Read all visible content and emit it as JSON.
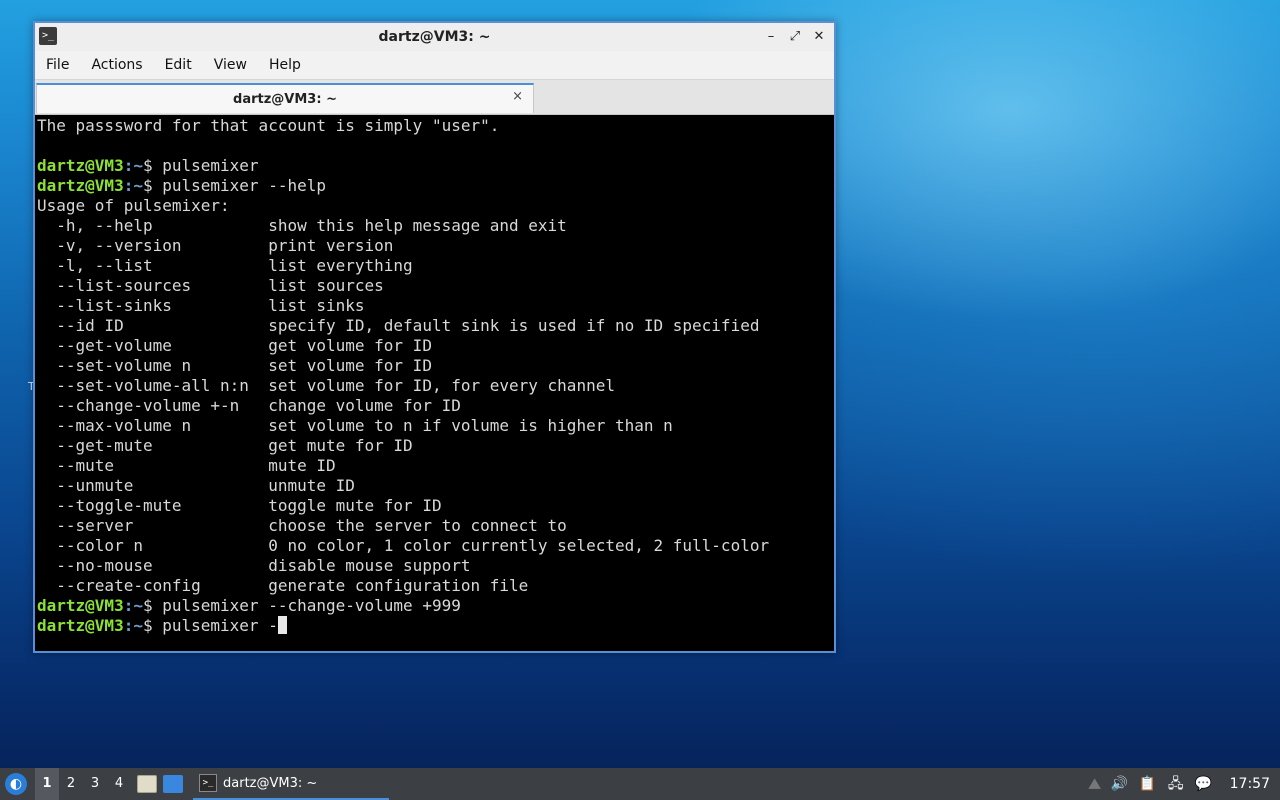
{
  "window": {
    "title": "dartz@VM3: ~",
    "app_icon": ">_",
    "controls": {
      "minimize": "–",
      "maximize": "⤢",
      "close": "✕"
    }
  },
  "menu": {
    "items": [
      "File",
      "Actions",
      "Edit",
      "View",
      "Help"
    ]
  },
  "tab": {
    "label": "dartz@VM3: ~",
    "close": "×"
  },
  "terminal": {
    "prompt_user": "dartz@VM3",
    "prompt_path": ":~",
    "prompt_symbol": "$ ",
    "lines": [
      {
        "type": "text",
        "text": "The passsword for that account is simply \"user\"."
      },
      {
        "type": "text",
        "text": ""
      },
      {
        "type": "prompt",
        "text": "pulsemixer"
      },
      {
        "type": "prompt",
        "text": "pulsemixer --help"
      },
      {
        "type": "text",
        "text": "Usage of pulsemixer:"
      },
      {
        "type": "text",
        "text": "  -h, --help            show this help message and exit"
      },
      {
        "type": "text",
        "text": "  -v, --version         print version"
      },
      {
        "type": "text",
        "text": "  -l, --list            list everything"
      },
      {
        "type": "text",
        "text": "  --list-sources        list sources"
      },
      {
        "type": "text",
        "text": "  --list-sinks          list sinks"
      },
      {
        "type": "text",
        "text": "  --id ID               specify ID, default sink is used if no ID specified"
      },
      {
        "type": "text",
        "text": "  --get-volume          get volume for ID"
      },
      {
        "type": "text",
        "text": "  --set-volume n        set volume for ID"
      },
      {
        "type": "text",
        "text": "  --set-volume-all n:n  set volume for ID, for every channel"
      },
      {
        "type": "text",
        "text": "  --change-volume +-n   change volume for ID"
      },
      {
        "type": "text",
        "text": "  --max-volume n        set volume to n if volume is higher than n"
      },
      {
        "type": "text",
        "text": "  --get-mute            get mute for ID"
      },
      {
        "type": "text",
        "text": "  --mute                mute ID"
      },
      {
        "type": "text",
        "text": "  --unmute              unmute ID"
      },
      {
        "type": "text",
        "text": "  --toggle-mute         toggle mute for ID"
      },
      {
        "type": "text",
        "text": "  --server              choose the server to connect to"
      },
      {
        "type": "text",
        "text": "  --color n             0 no color, 1 color currently selected, 2 full-color"
      },
      {
        "type": "text",
        "text": "  --no-mouse            disable mouse support"
      },
      {
        "type": "text",
        "text": "  --create-config       generate configuration file"
      },
      {
        "type": "prompt",
        "text": "pulsemixer --change-volume +999"
      },
      {
        "type": "prompt_active",
        "text": "pulsemixer -"
      }
    ]
  },
  "taskbar": {
    "start_icon": "start-menu-icon",
    "workspaces": [
      "1",
      "2",
      "3",
      "4"
    ],
    "active_workspace": "1",
    "task_label": "dartz@VM3: ~",
    "clock": "17:57"
  },
  "desktop": {
    "edge_glyph": "T"
  },
  "colors": {
    "prompt_user": "#8ae234",
    "prompt_path": "#729fcf",
    "accent": "#4a90d9"
  }
}
